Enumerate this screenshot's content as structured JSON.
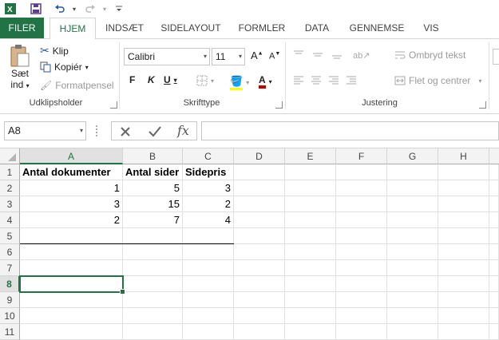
{
  "colors": {
    "accent": "#217346",
    "font_color_bar": "#c00000"
  },
  "qat": {
    "icons": [
      "excel-logo-icon",
      "save-icon",
      "undo-icon",
      "redo-icon",
      "customize-icon"
    ]
  },
  "tabs": [
    "FILER",
    "HJEM",
    "INDSÆT",
    "SIDELAYOUT",
    "FORMLER",
    "DATA",
    "GENNEMSE",
    "VIS"
  ],
  "ribbon": {
    "clipboard": {
      "paste_line1": "Sæt",
      "paste_line2": "ind",
      "cut": "Klip",
      "copy": "Kopiér",
      "format_painter": "Formatpensel",
      "label": "Udklipsholder"
    },
    "font": {
      "font_name": "Calibri",
      "font_size": "11",
      "bold": "F",
      "italic": "K",
      "underline": "U",
      "font_color_letter": "A",
      "label": "Skrifttype"
    },
    "alignment": {
      "wrap_text": "Ombryd tekst",
      "merge_center": "Flet og centrer",
      "label": "Justering"
    }
  },
  "formula_bar": {
    "name_box": "A8",
    "fx": "fx",
    "value": ""
  },
  "sheet": {
    "columns": [
      "A",
      "B",
      "C",
      "D",
      "E",
      "F",
      "G",
      "H"
    ],
    "rows": [
      "1",
      "2",
      "3",
      "4",
      "5",
      "6",
      "7",
      "8",
      "9",
      "10",
      "11"
    ],
    "active_cell": "A8",
    "header_row": [
      "Antal dokumenter",
      "Antal sider",
      "Sidepris"
    ],
    "data_rows": [
      [
        "1",
        "5",
        "3"
      ],
      [
        "3",
        "15",
        "2"
      ],
      [
        "2",
        "7",
        "4"
      ]
    ]
  }
}
